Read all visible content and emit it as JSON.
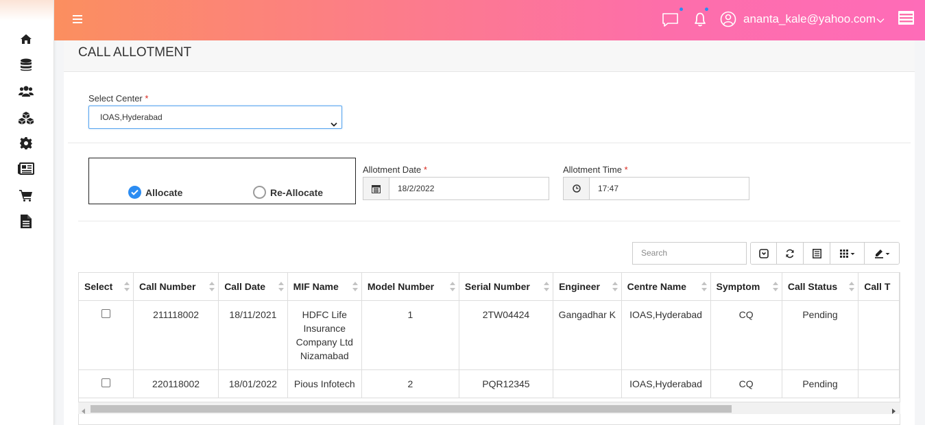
{
  "user": {
    "email": "ananta_kale@yahoo.com"
  },
  "page": {
    "title": "CALL ALLOTMENT"
  },
  "form": {
    "center_label": "Select Center",
    "required_mark": "*",
    "center_value": "IOAS,Hyderabad",
    "allocate_label": "Allocate",
    "reallocate_label": "Re-Allocate",
    "allocate_selected": true,
    "date_label": "Allotment Date",
    "date_value": "18/2/2022",
    "time_label": "Allotment Time",
    "time_value": "17:47"
  },
  "toolbar": {
    "search_placeholder": "Search"
  },
  "table": {
    "columns": [
      "Select",
      "Call Number",
      "Call Date",
      "MIF Name",
      "Model Number",
      "Serial Number",
      "Engineer",
      "Centre Name",
      "Symptom",
      "Call Status",
      "Call T"
    ],
    "rows": [
      {
        "call_number": "211118002",
        "call_date": "18/11/2021",
        "mif_name": "HDFC Life Insurance Company Ltd Nizamabad",
        "model_number": "1",
        "serial_number": "2TW04424",
        "engineer": "Gangadhar K",
        "centre_name": "IOAS,Hyderabad",
        "symptom": "CQ",
        "call_status": "Pending"
      },
      {
        "call_number": "220118002",
        "call_date": "18/01/2022",
        "mif_name": "Pious Infotech",
        "model_number": "2",
        "serial_number": "PQR12345",
        "engineer": "",
        "centre_name": "IOAS,Hyderabad",
        "symptom": "CQ",
        "call_status": "Pending"
      }
    ]
  },
  "colors": {
    "accent": "#2b8cf2",
    "topbar_start": "#fb8f5f",
    "topbar_end": "#fe6cb8",
    "required": "#d9261c"
  },
  "icons": [
    "home-icon",
    "database-icon",
    "users-icon",
    "cubes-icon",
    "gear-icon",
    "newspaper-icon",
    "cart-icon",
    "file-icon",
    "chat-icon",
    "bell-icon",
    "user-icon",
    "calendar-icon",
    "clock-icon",
    "toggle-icon",
    "refresh-icon",
    "list-icon",
    "columns-icon",
    "export-icon"
  ]
}
